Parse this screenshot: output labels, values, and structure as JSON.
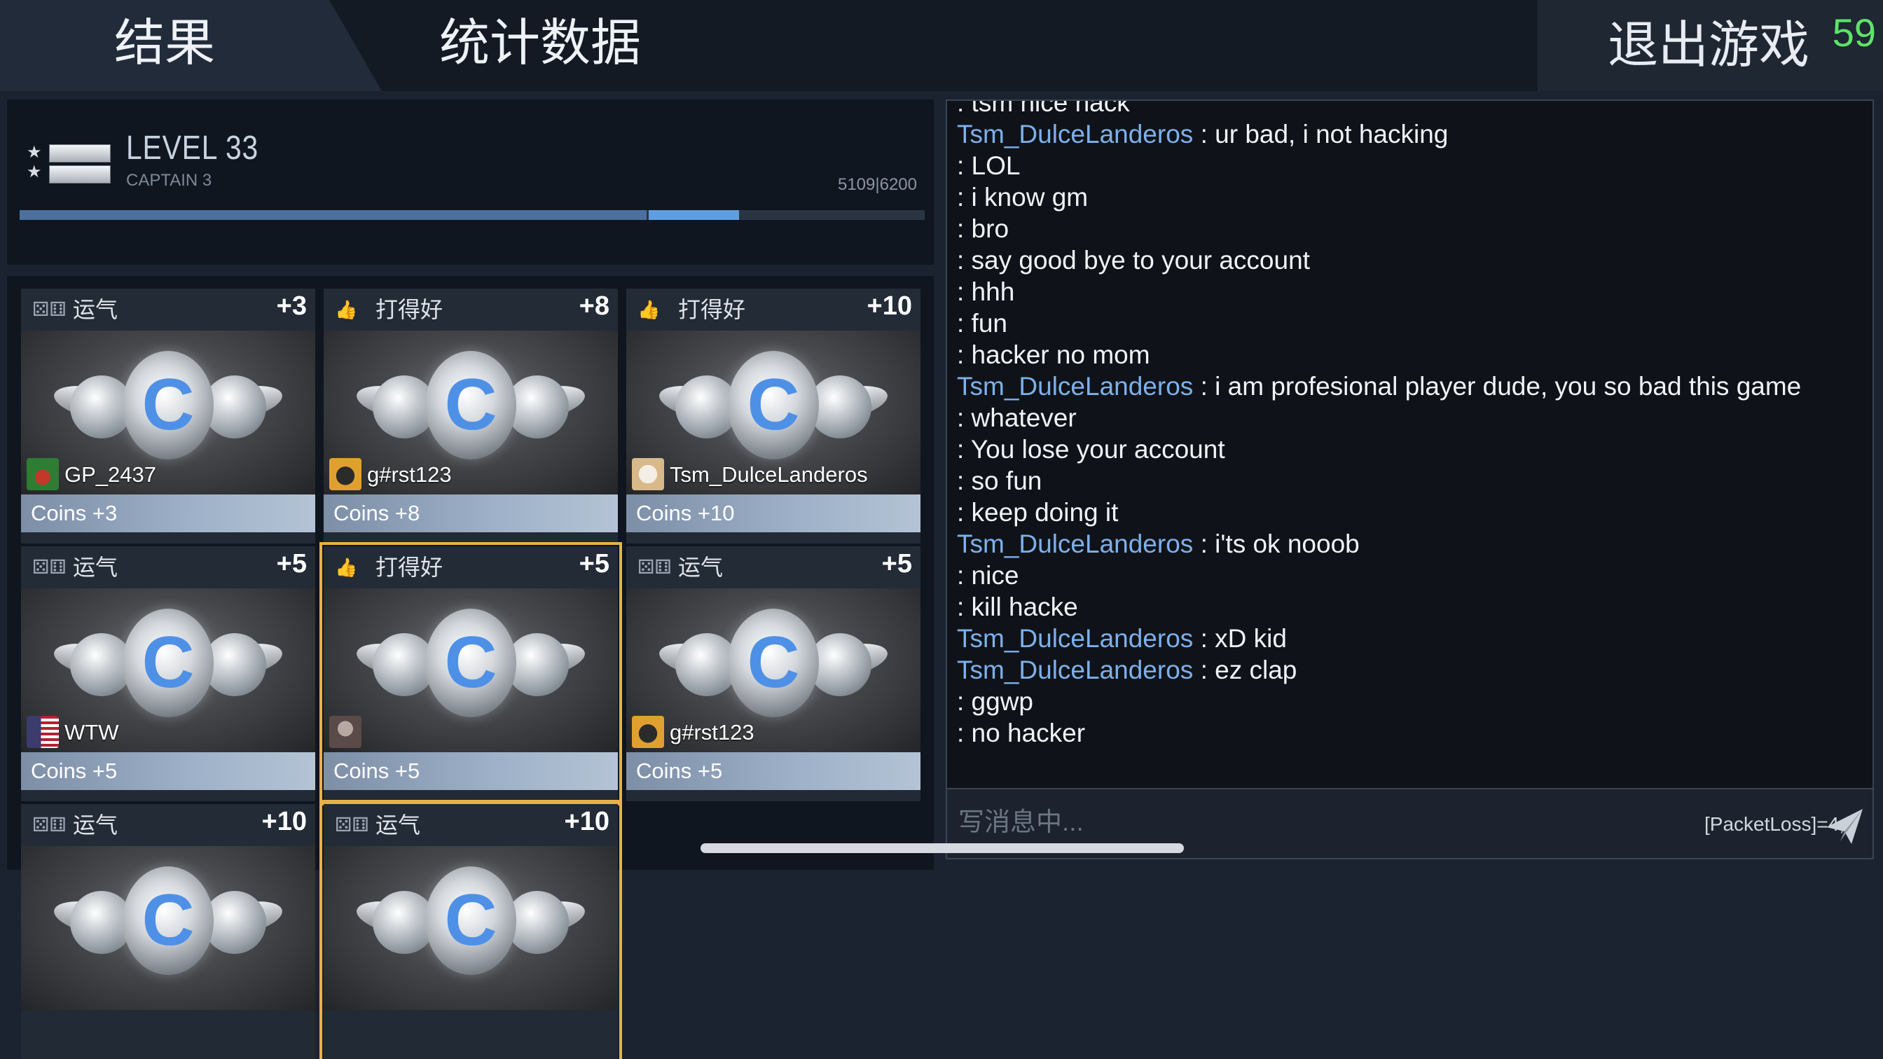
{
  "header": {
    "tab_results": "结果",
    "tab_stats": "统计数据",
    "exit_label": "退出游戏",
    "timer": "59"
  },
  "level": {
    "title": "LEVEL 33",
    "rank": "CAPTAIN 3",
    "xp_text": "5109|6200",
    "xp_fraction_before": 0.695,
    "xp_fraction_after": 0.795
  },
  "rewards": [
    {
      "category": "运气",
      "icon": "dice-icon",
      "bonus": "+3",
      "player": "GP_2437",
      "avatar": "frog-avatar",
      "coins": "Coins +3",
      "highlight": false
    },
    {
      "category": "打得好",
      "icon": "thumbs-up-icon",
      "bonus": "+8",
      "player": "g#rst123",
      "avatar": "dog-avatar",
      "coins": "Coins +8",
      "highlight": false
    },
    {
      "category": "打得好",
      "icon": "thumbs-up-icon",
      "bonus": "+10",
      "player": "Tsm_DulceLanderos",
      "avatar": "cat-avatar",
      "coins": "Coins +10",
      "highlight": false
    },
    {
      "category": "运气",
      "icon": "dice-icon",
      "bonus": "+5",
      "player": "WTW",
      "avatar": "us-flag-avatar",
      "coins": "Coins +5",
      "highlight": false
    },
    {
      "category": "打得好",
      "icon": "thumbs-up-icon",
      "bonus": "+5",
      "player": "",
      "avatar": "person-avatar",
      "coins": "Coins +5",
      "highlight": true
    },
    {
      "category": "运气",
      "icon": "dice-icon",
      "bonus": "+5",
      "player": "g#rst123",
      "avatar": "dog-avatar",
      "coins": "Coins +5",
      "highlight": false
    },
    {
      "category": "运气",
      "icon": "dice-icon",
      "bonus": "+10",
      "player": "",
      "avatar": "",
      "coins": "",
      "highlight": false
    },
    {
      "category": "运气",
      "icon": "dice-icon",
      "bonus": "+10",
      "player": "",
      "avatar": "",
      "coins": "",
      "highlight": true
    }
  ],
  "chat": {
    "messages": [
      {
        "sender": "",
        "text": ": tsm nice hack"
      },
      {
        "sender": "Tsm_DulceLanderos",
        "text": " : ur bad, i not hacking"
      },
      {
        "sender": "",
        "text": " : LOL"
      },
      {
        "sender": "",
        "text": " : i know gm"
      },
      {
        "sender": "",
        "text": " : bro"
      },
      {
        "sender": "",
        "text": " : say good bye to your account"
      },
      {
        "sender": "",
        "text": " : hhh"
      },
      {
        "sender": "",
        "text": " : fun"
      },
      {
        "sender": "",
        "text": " : hacker no mom"
      },
      {
        "sender": "Tsm_DulceLanderos",
        "text": " : i am profesional player dude, you so bad this game"
      },
      {
        "sender": "",
        "text": " : whatever"
      },
      {
        "sender": "",
        "text": " : You lose your account"
      },
      {
        "sender": "",
        "text": " : so fun"
      },
      {
        "sender": "",
        "text": " : keep doing it"
      },
      {
        "sender": "Tsm_DulceLanderos",
        "text": " : i'ts ok nooob"
      },
      {
        "sender": "",
        "text": " : nice"
      },
      {
        "sender": "",
        "text": " : kill hacke"
      },
      {
        "sender": "Tsm_DulceLanderos",
        "text": " : xD kid"
      },
      {
        "sender": "Tsm_DulceLanderos",
        "text": " : ez clap"
      },
      {
        "sender": "",
        "text": " : ggwp"
      },
      {
        "sender": "",
        "text": " : no hacker"
      }
    ],
    "input_placeholder": "写消息中...",
    "status": "[PacketLoss]=4;"
  }
}
